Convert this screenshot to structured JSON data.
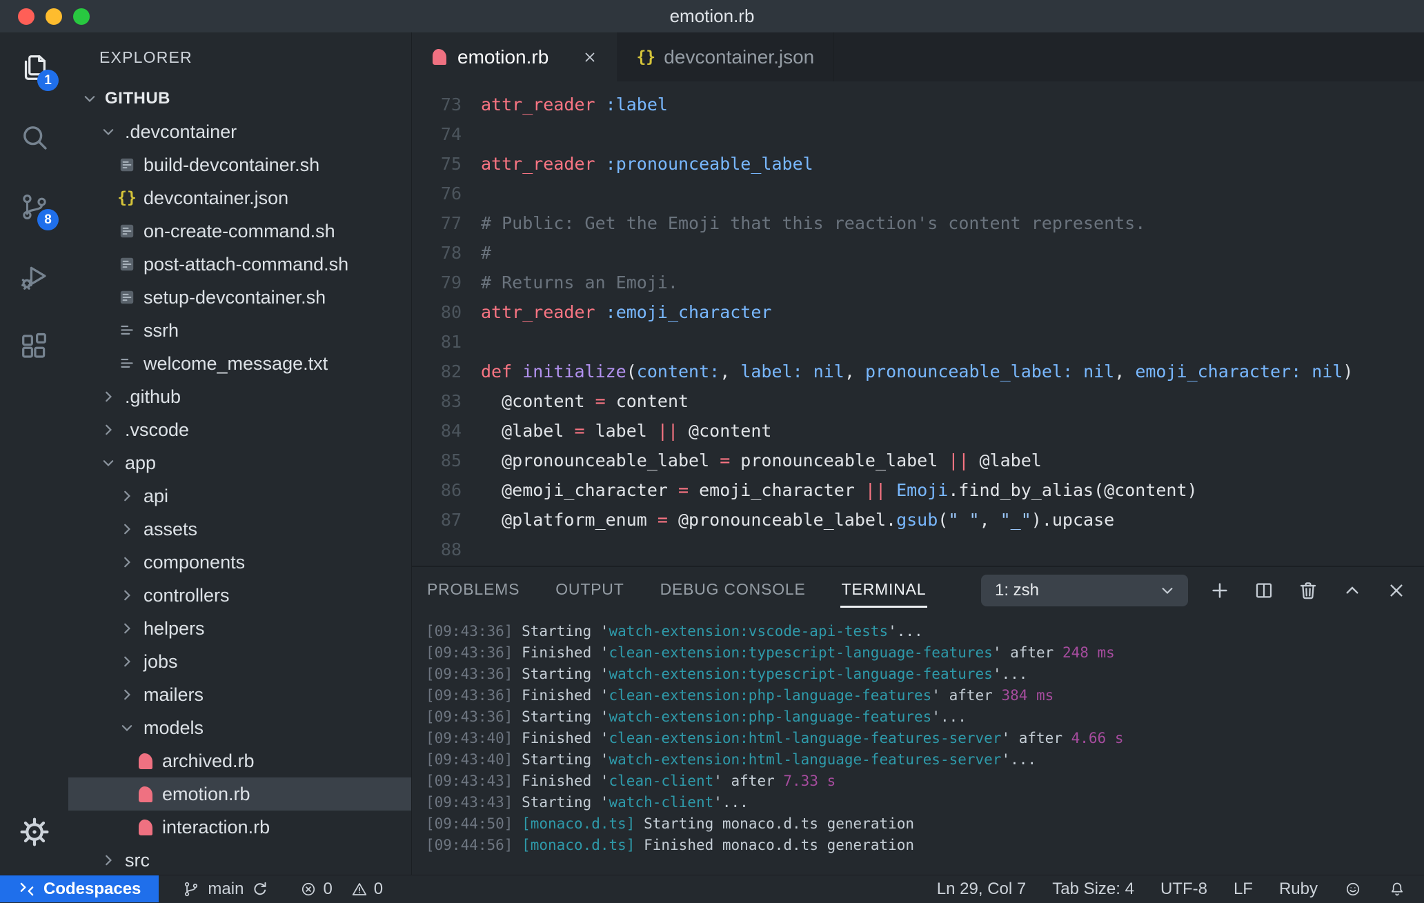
{
  "window": {
    "title": "emotion.rb"
  },
  "colors": {
    "accent_blue": "#1f6feb",
    "titlebar_bg": "#2f363d",
    "chrome_bg": "#24292e",
    "strip_bg": "#1f2328",
    "border": "#1b1f23",
    "selected_row_bg": "#3a4149",
    "ruby_pink": "#ef7181",
    "json_yellow": "#d5c43a",
    "traffic_lights": [
      "#ff5f57",
      "#febc2e",
      "#28c840"
    ],
    "syntax": {
      "keyword": "#f97583",
      "function": "#b392f0",
      "symbol": "#79b8ff",
      "string": "#9ecbff",
      "comment": "#6a737d",
      "plain": "#e1e4e8",
      "line_number": "#4c555d"
    },
    "terminal": {
      "timestamp": "#6e7681",
      "plain": "#c5ced6",
      "task": "#2e9aaa",
      "duration": "#a64c9e"
    }
  },
  "activity_bar": {
    "items": [
      {
        "name": "explorer",
        "icon": "files",
        "active": true,
        "badge": "1"
      },
      {
        "name": "search",
        "icon": "search",
        "active": false
      },
      {
        "name": "source-control",
        "icon": "source-control",
        "active": false,
        "badge": "8"
      },
      {
        "name": "run-debug",
        "icon": "debug",
        "active": false
      },
      {
        "name": "extensions",
        "icon": "extensions",
        "active": false
      }
    ],
    "bottom_items": [
      {
        "name": "settings",
        "icon": "gear"
      }
    ]
  },
  "explorer": {
    "header": "EXPLORER",
    "tree": [
      {
        "label": "GITHUB",
        "level": 0,
        "kind": "root",
        "expanded": true
      },
      {
        "label": ".devcontainer",
        "level": 1,
        "kind": "folder",
        "expanded": true
      },
      {
        "label": "build-devcontainer.sh",
        "level": 2,
        "kind": "file",
        "icon": "shell"
      },
      {
        "label": "devcontainer.json",
        "level": 2,
        "kind": "file",
        "icon": "json"
      },
      {
        "label": "on-create-command.sh",
        "level": 2,
        "kind": "file",
        "icon": "shell"
      },
      {
        "label": "post-attach-command.sh",
        "level": 2,
        "kind": "file",
        "icon": "shell"
      },
      {
        "label": "setup-devcontainer.sh",
        "level": 2,
        "kind": "file",
        "icon": "shell"
      },
      {
        "label": "ssrh",
        "level": 2,
        "kind": "file",
        "icon": "textlines"
      },
      {
        "label": "welcome_message.txt",
        "level": 2,
        "kind": "file",
        "icon": "textlines"
      },
      {
        "label": ".github",
        "level": 1,
        "kind": "folder",
        "expanded": false
      },
      {
        "label": ".vscode",
        "level": 1,
        "kind": "folder",
        "expanded": false
      },
      {
        "label": "app",
        "level": 1,
        "kind": "folder",
        "expanded": true
      },
      {
        "label": "api",
        "level": 2,
        "kind": "folder",
        "expanded": false
      },
      {
        "label": "assets",
        "level": 2,
        "kind": "folder",
        "expanded": false
      },
      {
        "label": "components",
        "level": 2,
        "kind": "folder",
        "expanded": false
      },
      {
        "label": "controllers",
        "level": 2,
        "kind": "folder",
        "expanded": false
      },
      {
        "label": "helpers",
        "level": 2,
        "kind": "folder",
        "expanded": false
      },
      {
        "label": "jobs",
        "level": 2,
        "kind": "folder",
        "expanded": false
      },
      {
        "label": "mailers",
        "level": 2,
        "kind": "folder",
        "expanded": false
      },
      {
        "label": "models",
        "level": 2,
        "kind": "folder",
        "expanded": true
      },
      {
        "label": "archived.rb",
        "level": 3,
        "kind": "file",
        "icon": "ruby"
      },
      {
        "label": "emotion.rb",
        "level": 3,
        "kind": "file",
        "icon": "ruby",
        "selected": true
      },
      {
        "label": "interaction.rb",
        "level": 3,
        "kind": "file",
        "icon": "ruby"
      },
      {
        "label": "src",
        "level": 1,
        "kind": "folder",
        "expanded": false
      }
    ]
  },
  "editor_tabs": [
    {
      "label": "emotion.rb",
      "icon": "ruby",
      "active": true,
      "closable": true
    },
    {
      "label": "devcontainer.json",
      "icon": "json",
      "active": false,
      "closable": false
    }
  ],
  "editor": {
    "lines": [
      {
        "n": "73",
        "t": [
          [
            "kw",
            "attr_reader"
          ],
          [
            "pln",
            " "
          ],
          [
            "sym",
            ":label"
          ]
        ]
      },
      {
        "n": "74",
        "t": []
      },
      {
        "n": "75",
        "t": [
          [
            "kw",
            "attr_reader"
          ],
          [
            "pln",
            " "
          ],
          [
            "sym",
            ":pronounceable_label"
          ]
        ]
      },
      {
        "n": "76",
        "t": []
      },
      {
        "n": "77",
        "t": [
          [
            "com",
            "# Public: Get the Emoji that this reaction's content represents."
          ]
        ]
      },
      {
        "n": "78",
        "t": [
          [
            "com",
            "#"
          ]
        ]
      },
      {
        "n": "79",
        "t": [
          [
            "com",
            "# Returns an Emoji."
          ]
        ]
      },
      {
        "n": "80",
        "t": [
          [
            "kw",
            "attr_reader"
          ],
          [
            "pln",
            " "
          ],
          [
            "sym",
            ":emoji_character"
          ]
        ]
      },
      {
        "n": "81",
        "t": []
      },
      {
        "n": "82",
        "t": [
          [
            "kw",
            "def"
          ],
          [
            "pln",
            " "
          ],
          [
            "fn",
            "initialize"
          ],
          [
            "pln",
            "("
          ],
          [
            "sym",
            "content:"
          ],
          [
            "pln",
            ", "
          ],
          [
            "sym",
            "label:"
          ],
          [
            "pln",
            " "
          ],
          [
            "sym",
            "nil"
          ],
          [
            "pln",
            ", "
          ],
          [
            "sym",
            "pronounceable_label:"
          ],
          [
            "pln",
            " "
          ],
          [
            "sym",
            "nil"
          ],
          [
            "pln",
            ", "
          ],
          [
            "sym",
            "emoji_character:"
          ],
          [
            "pln",
            " "
          ],
          [
            "sym",
            "nil"
          ],
          [
            "pln",
            ")"
          ]
        ]
      },
      {
        "n": "83",
        "t": [
          [
            "pln",
            "  @content "
          ],
          [
            "kw",
            "="
          ],
          [
            "pln",
            " content"
          ]
        ]
      },
      {
        "n": "84",
        "t": [
          [
            "pln",
            "  @label "
          ],
          [
            "kw",
            "="
          ],
          [
            "pln",
            " label "
          ],
          [
            "kw",
            "||"
          ],
          [
            "pln",
            " @content"
          ]
        ]
      },
      {
        "n": "85",
        "t": [
          [
            "pln",
            "  @pronounceable_label "
          ],
          [
            "kw",
            "="
          ],
          [
            "pln",
            " pronounceable_label "
          ],
          [
            "kw",
            "||"
          ],
          [
            "pln",
            " @label"
          ]
        ]
      },
      {
        "n": "86",
        "t": [
          [
            "pln",
            "  @emoji_character "
          ],
          [
            "kw",
            "="
          ],
          [
            "pln",
            " emoji_character "
          ],
          [
            "kw",
            "||"
          ],
          [
            "pln",
            " "
          ],
          [
            "sym",
            "Emoji"
          ],
          [
            "pln",
            ".find_by_alias(@content)"
          ]
        ]
      },
      {
        "n": "87",
        "t": [
          [
            "pln",
            "  @platform_enum "
          ],
          [
            "kw",
            "="
          ],
          [
            "pln",
            " @pronounceable_label."
          ],
          [
            "sym",
            "gsub"
          ],
          [
            "pln",
            "("
          ],
          [
            "str",
            "\" \""
          ],
          [
            "pln",
            ", "
          ],
          [
            "str",
            "\"_\""
          ],
          [
            "pln",
            ").upcase"
          ]
        ]
      },
      {
        "n": "88",
        "t": []
      }
    ]
  },
  "panel": {
    "tabs": [
      {
        "label": "PROBLEMS",
        "active": false
      },
      {
        "label": "OUTPUT",
        "active": false
      },
      {
        "label": "DEBUG CONSOLE",
        "active": false
      },
      {
        "label": "TERMINAL",
        "active": true
      }
    ],
    "shell_select": "1: zsh",
    "actions": [
      {
        "name": "new-terminal",
        "icon": "plus"
      },
      {
        "name": "split-terminal",
        "icon": "split"
      },
      {
        "name": "kill-terminal",
        "icon": "trash"
      },
      {
        "name": "maximize-panel",
        "icon": "chevron-up"
      },
      {
        "name": "close-panel",
        "icon": "close"
      }
    ],
    "terminal_lines": [
      [
        [
          "ts",
          "[09:43:36]"
        ],
        [
          "pln",
          " Starting '"
        ],
        [
          "task",
          "watch-extension:vscode-api-tests"
        ],
        [
          "pln",
          "'..."
        ]
      ],
      [
        [
          "ts",
          "[09:43:36]"
        ],
        [
          "pln",
          " Finished '"
        ],
        [
          "task",
          "clean-extension:typescript-language-features"
        ],
        [
          "pln",
          "' after "
        ],
        [
          "dur",
          "248 ms"
        ]
      ],
      [
        [
          "ts",
          "[09:43:36]"
        ],
        [
          "pln",
          " Starting '"
        ],
        [
          "task",
          "watch-extension:typescript-language-features"
        ],
        [
          "pln",
          "'..."
        ]
      ],
      [
        [
          "ts",
          "[09:43:36]"
        ],
        [
          "pln",
          " Finished '"
        ],
        [
          "task",
          "clean-extension:php-language-features"
        ],
        [
          "pln",
          "' after "
        ],
        [
          "dur",
          "384 ms"
        ]
      ],
      [
        [
          "ts",
          "[09:43:36]"
        ],
        [
          "pln",
          " Starting '"
        ],
        [
          "task",
          "watch-extension:php-language-features"
        ],
        [
          "pln",
          "'..."
        ]
      ],
      [
        [
          "ts",
          "[09:43:40]"
        ],
        [
          "pln",
          " Finished '"
        ],
        [
          "task",
          "clean-extension:html-language-features-server"
        ],
        [
          "pln",
          "' after "
        ],
        [
          "dur",
          "4.66 s"
        ]
      ],
      [
        [
          "ts",
          "[09:43:40]"
        ],
        [
          "pln",
          " Starting '"
        ],
        [
          "task",
          "watch-extension:html-language-features-server"
        ],
        [
          "pln",
          "'..."
        ]
      ],
      [
        [
          "ts",
          "[09:43:43]"
        ],
        [
          "pln",
          " Finished '"
        ],
        [
          "task",
          "clean-client"
        ],
        [
          "pln",
          "' after "
        ],
        [
          "dur",
          "7.33 s"
        ]
      ],
      [
        [
          "ts",
          "[09:43:43]"
        ],
        [
          "pln",
          " Starting '"
        ],
        [
          "task",
          "watch-client"
        ],
        [
          "pln",
          "'..."
        ]
      ],
      [
        [
          "ts",
          "[09:44:50]"
        ],
        [
          "pln",
          " "
        ],
        [
          "task",
          "[monaco.d.ts]"
        ],
        [
          "pln",
          " Starting monaco.d.ts generation"
        ]
      ],
      [
        [
          "ts",
          "[09:44:56]"
        ],
        [
          "pln",
          " "
        ],
        [
          "task",
          "[monaco.d.ts]"
        ],
        [
          "pln",
          " Finished monaco.d.ts generation"
        ]
      ]
    ]
  },
  "status_bar": {
    "codespaces_label": "Codespaces",
    "branch_label": "main",
    "error_count": "0",
    "warning_count": "0",
    "right_items": [
      {
        "name": "cursor-position",
        "label": "Ln 29, Col 7"
      },
      {
        "name": "tab-size",
        "label": "Tab Size: 4"
      },
      {
        "name": "encoding",
        "label": "UTF-8"
      },
      {
        "name": "eol",
        "label": "LF"
      },
      {
        "name": "language-mode",
        "label": "Ruby"
      },
      {
        "name": "feedback",
        "icon": "smiley"
      },
      {
        "name": "notifications",
        "icon": "bell"
      }
    ]
  }
}
